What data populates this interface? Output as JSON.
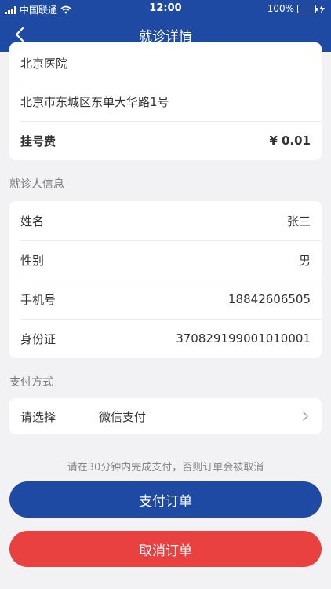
{
  "status_bar": {
    "carrier": "中国联通",
    "time": "12:00",
    "battery": "100%"
  },
  "header": {
    "title": "就诊详情"
  },
  "hospital": {
    "name": "北京医院",
    "address": "北京市东城区东单大华路1号",
    "fee_label": "挂号费",
    "fee_value": "¥ 0.01"
  },
  "patient": {
    "section_title": "就诊人信息",
    "rows": [
      {
        "label": "姓名",
        "value": "张三"
      },
      {
        "label": "性别",
        "value": "男"
      },
      {
        "label": "手机号",
        "value": "18842606505"
      },
      {
        "label": "身份证",
        "value": "370829199001010001"
      }
    ]
  },
  "payment": {
    "section_title": "支付方式",
    "select_label": "请选择",
    "method": "微信支付"
  },
  "notice": "请在30分钟内完成支付，否则订单会被取消",
  "buttons": {
    "pay": "支付订单",
    "cancel": "取消订单"
  },
  "colors": {
    "primary": "#1e4aa3",
    "danger": "#e84140",
    "background": "#f2f2f4"
  }
}
